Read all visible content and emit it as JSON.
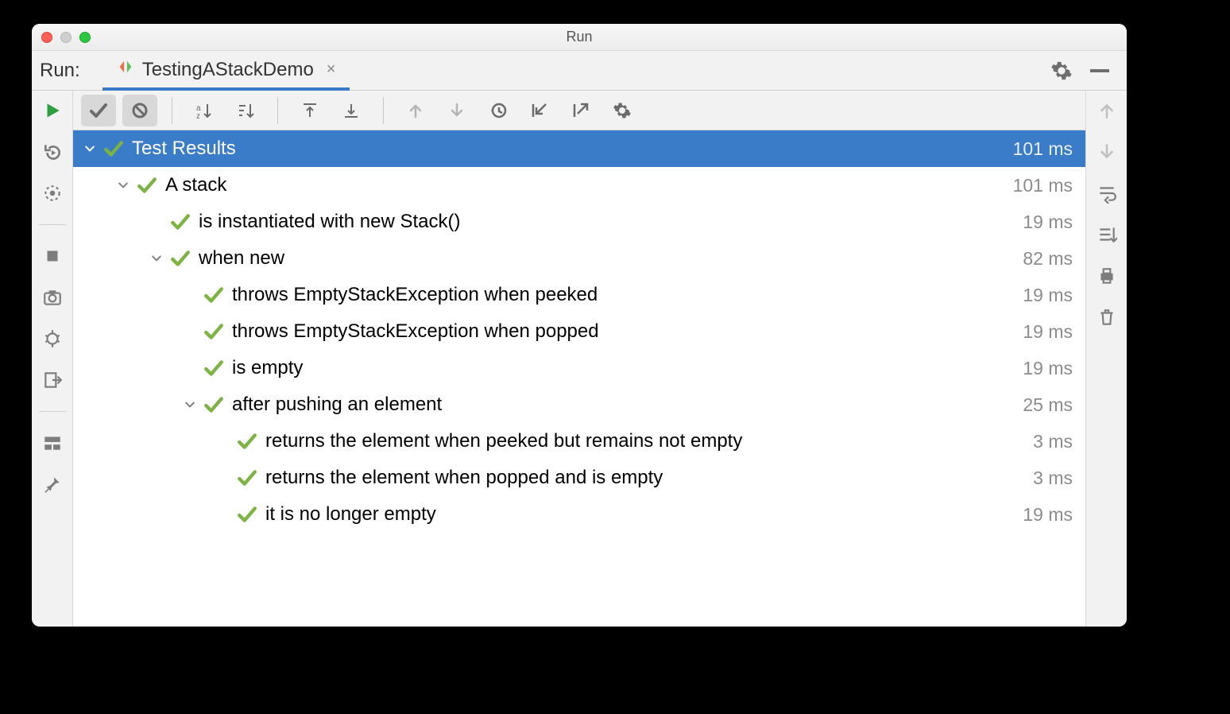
{
  "window": {
    "title": "Run"
  },
  "tab": {
    "runLabel": "Run:",
    "label": "TestingAStackDemo"
  },
  "tree": {
    "root": {
      "label": "Test Results",
      "time": "101 ms"
    },
    "n1": {
      "label": "A stack",
      "time": "101 ms"
    },
    "n1_1": {
      "label": "is instantiated with new Stack()",
      "time": "19 ms"
    },
    "n1_2": {
      "label": "when new",
      "time": "82 ms"
    },
    "n1_2_1": {
      "label": "throws EmptyStackException when peeked",
      "time": "19 ms"
    },
    "n1_2_2": {
      "label": "throws EmptyStackException when popped",
      "time": "19 ms"
    },
    "n1_2_3": {
      "label": "is empty",
      "time": "19 ms"
    },
    "n1_3": {
      "label": "after pushing an element",
      "time": "25 ms"
    },
    "n1_3_1": {
      "label": "returns the element when peeked but remains not empty",
      "time": "3 ms"
    },
    "n1_3_2": {
      "label": "returns the element when popped and is empty",
      "time": "3 ms"
    },
    "n1_3_3": {
      "label": "it is no longer empty",
      "time": "19 ms"
    }
  }
}
